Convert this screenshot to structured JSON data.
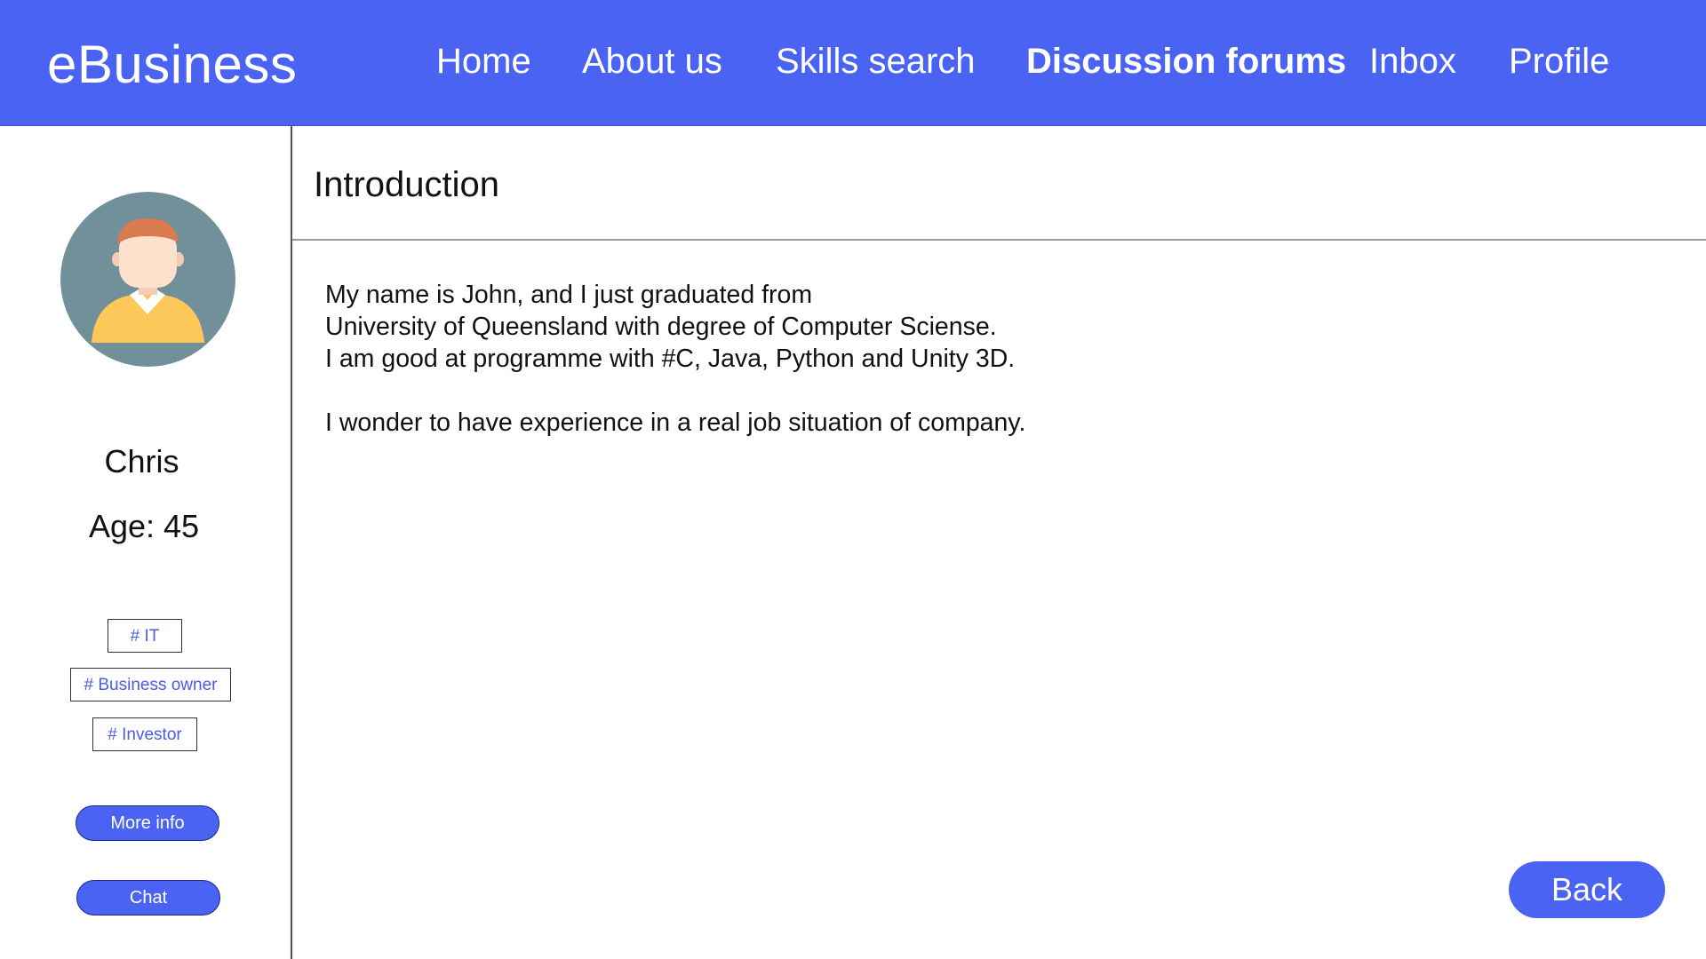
{
  "app": {
    "brand": "eBusiness"
  },
  "nav": {
    "items": [
      {
        "label": "Home",
        "active": false
      },
      {
        "label": "About us",
        "active": false
      },
      {
        "label": "Skills search",
        "active": false
      },
      {
        "label": "Discussion forums",
        "active": true
      },
      {
        "label": "Inbox",
        "active": false
      },
      {
        "label": "Profile",
        "active": false
      }
    ]
  },
  "profile": {
    "avatar_icon": "user-avatar-icon",
    "name": "Chris",
    "age_text": "Age: 45",
    "tags": [
      "# IT",
      "# Business owner",
      "# Investor"
    ],
    "more_info_label": "More info",
    "chat_label": "Chat"
  },
  "main": {
    "section_title": "Introduction",
    "intro_lines": [
      "My name is John, and I just graduated from",
      "University of Queensland with degree of Computer Sciense.",
      "I am good at programme with #C, Java, Python and Unity 3D."
    ],
    "intro_closing": "I wonder to have experience in a real job situation of company.",
    "back_label": "Back"
  },
  "colors": {
    "accent": "#4a63f2",
    "tag_text": "#4a5be8",
    "avatar_bg": "#72909a",
    "avatar_shirt": "#fdc85a",
    "avatar_hair": "#d97b4f",
    "avatar_skin": "#fde1cc"
  }
}
